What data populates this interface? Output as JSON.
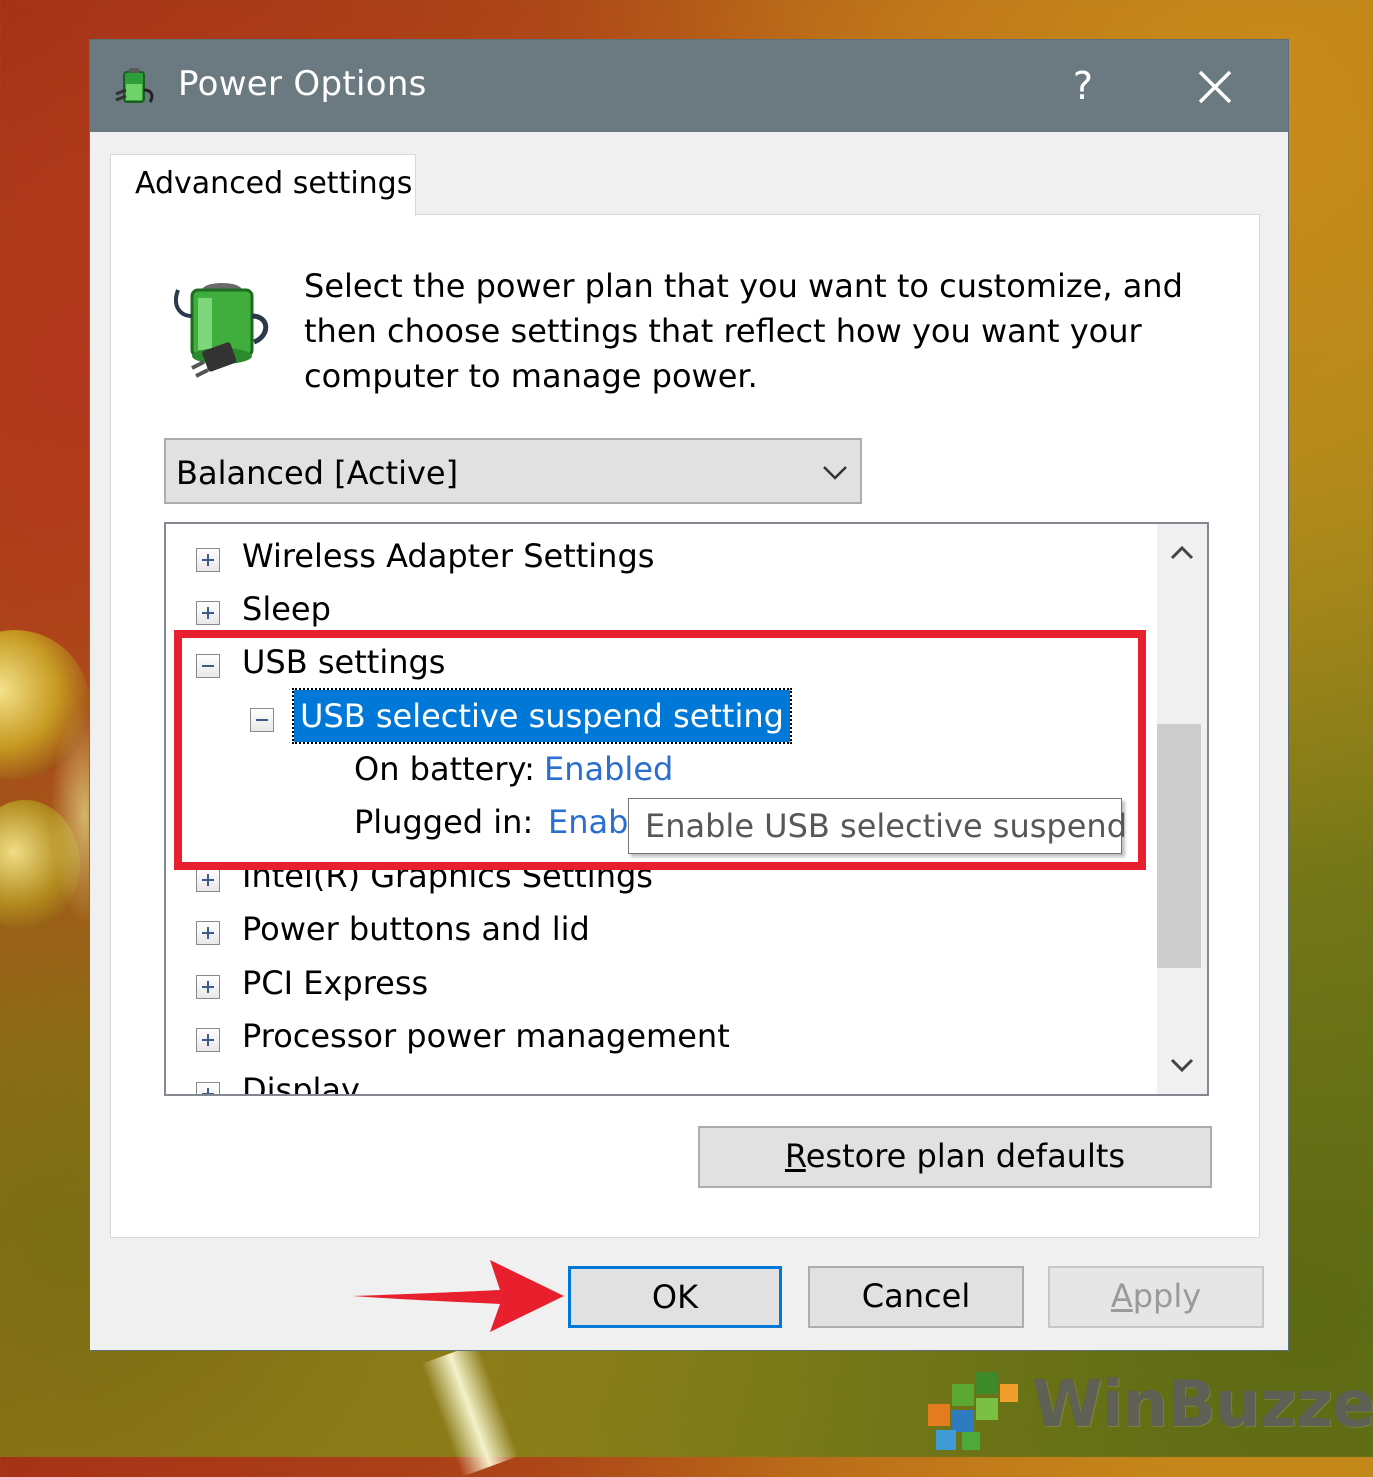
{
  "window": {
    "title": "Power Options",
    "help_label": "?",
    "icon": "power-options-icon"
  },
  "tabs": [
    {
      "label": "Advanced settings",
      "selected": true
    }
  ],
  "description": "Select the power plan that you want to customize, and then choose settings that reflect how you want your computer to manage power.",
  "plan_select": {
    "value": "Balanced [Active]"
  },
  "tree": {
    "items": [
      {
        "label": "Wireless Adapter Settings",
        "expanded": false
      },
      {
        "label": "Sleep",
        "expanded": false
      },
      {
        "label": "USB settings",
        "expanded": true,
        "children": [
          {
            "label": "USB selective suspend setting",
            "expanded": true,
            "selected": true,
            "values": [
              {
                "label": "On battery:",
                "value": "Enabled"
              },
              {
                "label": "Plugged in:",
                "value": "Enab"
              }
            ]
          }
        ]
      },
      {
        "label": "Intel(R) Graphics Settings",
        "expanded": false
      },
      {
        "label": "Power buttons and lid",
        "expanded": false
      },
      {
        "label": "PCI Express",
        "expanded": false
      },
      {
        "label": "Processor power management",
        "expanded": false
      },
      {
        "label": "Display",
        "expanded": false
      }
    ],
    "tooltip": "Enable USB selective suspend"
  },
  "buttons": {
    "restore_accel": "R",
    "restore_rest": "estore plan defaults",
    "ok": "OK",
    "cancel": "Cancel",
    "apply_accel": "A",
    "apply_rest": "pply"
  },
  "watermark": {
    "text": "WinBuzzer"
  },
  "colors": {
    "title_bar": "#6b7a80",
    "selection": "#0078d7",
    "link_value": "#2a6ecf",
    "highlight_annotation": "#e8202e"
  }
}
